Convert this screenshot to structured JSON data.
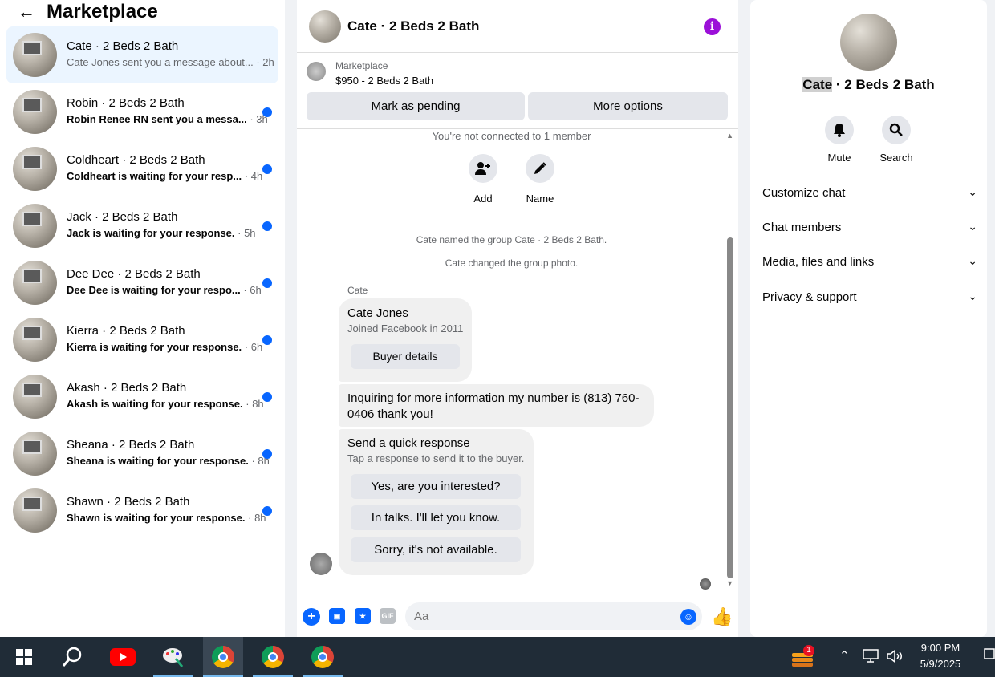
{
  "sidebar": {
    "title": "Marketplace",
    "conversations": [
      {
        "name": "Cate · 2 Beds 2 Bath",
        "preview": "Cate Jones sent you a message about...",
        "time": "· 2h"
      },
      {
        "name": "Robin · 2 Beds 2 Bath",
        "preview": "Robin Renee RN sent you a messa...",
        "time": "· 3h"
      },
      {
        "name": "Coldheart · 2 Beds 2 Bath",
        "preview": "Coldheart is waiting for your resp...",
        "time": "· 4h"
      },
      {
        "name": "Jack · 2 Beds 2 Bath",
        "preview": "Jack is waiting for your response.",
        "time": "· 5h"
      },
      {
        "name": "Dee Dee · 2 Beds 2 Bath",
        "preview": "Dee Dee is waiting for your respo...",
        "time": "· 6h"
      },
      {
        "name": "Kierra · 2 Beds 2 Bath",
        "preview": "Kierra is waiting for your response.",
        "time": "· 6h"
      },
      {
        "name": "Akash · 2 Beds 2 Bath",
        "preview": "Akash is waiting for your response.",
        "time": "· 8h"
      },
      {
        "name": "Sheana · 2 Beds 2 Bath",
        "preview": "Sheana is waiting for your response.",
        "time": "· 8h"
      },
      {
        "name": "Shawn · 2 Beds 2 Bath",
        "preview": "Shawn is waiting for your response.",
        "time": "· 8h"
      }
    ]
  },
  "chat": {
    "title": "Cate · 2 Beds 2 Bath",
    "listing_label": "Marketplace",
    "listing_price": "$950 - 2 Beds 2 Bath",
    "mark_pending": "Mark as pending",
    "more_options": "More options",
    "not_connected": "You're not connected to 1 member",
    "add_label": "Add",
    "name_label": "Name",
    "sys1": "Cate named the group Cate · 2 Beds 2 Bath.",
    "sys2": "Cate changed the group photo.",
    "sender": "Cate",
    "buyer_name": "Cate Jones",
    "buyer_joined": "Joined Facebook in 2011",
    "buyer_details": "Buyer details",
    "message": "Inquiring for more information my number is (813) 760-0406 thank you!",
    "quick_title": "Send a quick response",
    "quick_sub": "Tap a response to send it to the buyer.",
    "quick_responses": [
      "Yes, are you interested?",
      "In talks. I'll let you know.",
      "Sorry, it's not available."
    ],
    "composer_placeholder": "Aa"
  },
  "details": {
    "name_first": "Cate",
    "name_rest": " · 2 Beds 2 Bath",
    "mute": "Mute",
    "search": "Search",
    "sections": [
      "Customize chat",
      "Chat members",
      "Media, files and links",
      "Privacy & support"
    ]
  },
  "taskbar": {
    "time": "9:00 PM",
    "date": "5/9/2025",
    "notification_count": "1"
  },
  "colors": {
    "accent": "#0866ff",
    "info": "#9b10d8",
    "taskbar": "#202c37"
  }
}
